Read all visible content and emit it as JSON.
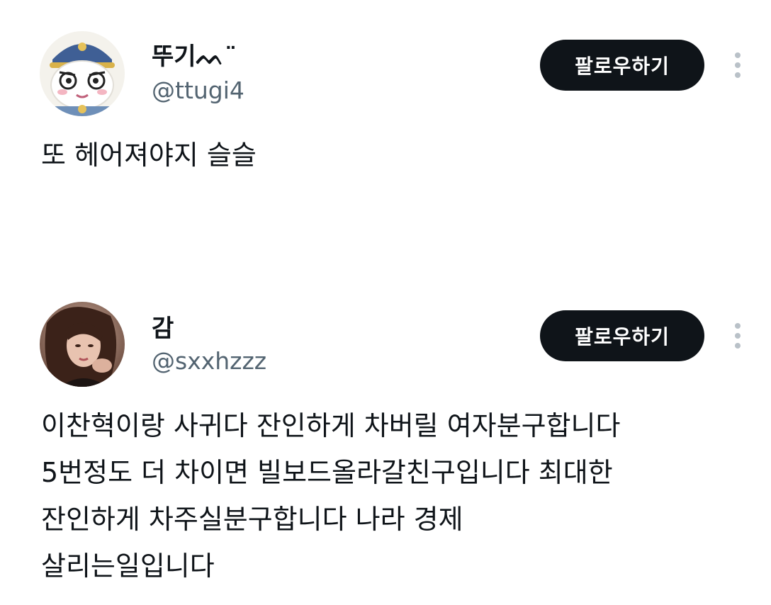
{
  "tweets": [
    {
      "display_name": "뚜기ᨓ¨",
      "handle": "@ttugi4",
      "follow_label": "팔로우하기",
      "text": "또 헤어져야지 슬슬"
    },
    {
      "display_name": "감",
      "handle": "@sxxhzzz",
      "follow_label": "팔로우하기",
      "text": "이찬혁이랑 사귀다 잔인하게 차버릴 여자분구합니다\n5번정도 더 차이면 빌보드올라갈친구입니다 최대한\n잔인하게 차주실분구합니다 나라 경제\n살리는일입니다"
    }
  ],
  "colors": {
    "text": "#0f1419",
    "secondary": "#536471",
    "button_bg": "#0f1419",
    "button_text": "#ffffff",
    "more_icon": "#b9c1c8"
  },
  "icons": {
    "more": "more-vertical-icon"
  }
}
